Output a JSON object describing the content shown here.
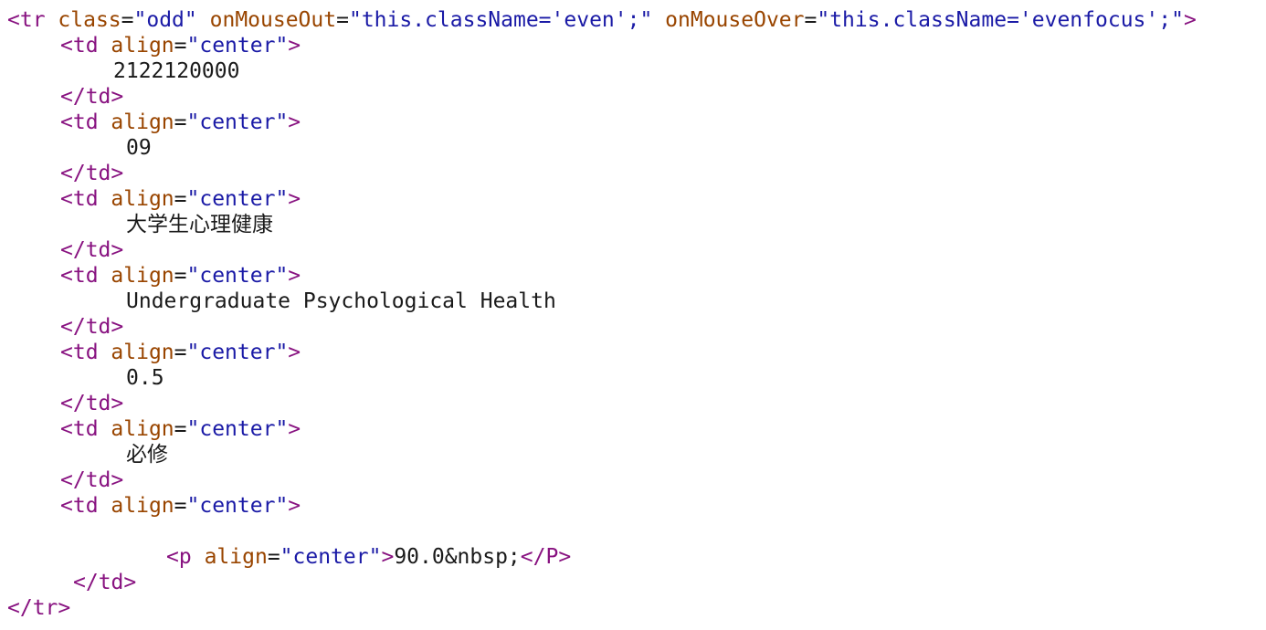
{
  "row_open": {
    "tag_open": "<tr",
    "attr_class": "class",
    "val_class": "\"odd\"",
    "attr_out": "onMouseOut",
    "val_out": "\"this.className='even';\"",
    "attr_over": "onMouseOver",
    "val_over": "\"this.className='evenfocus';\"",
    "close": ">"
  },
  "td_open": {
    "tag": "<td",
    "attr": "align",
    "val": "\"center\"",
    "close": ">"
  },
  "td_close": "</td>",
  "row_close": "</tr>",
  "cells": [
    "2122120000",
    "09",
    "大学生心理健康",
    "Undergraduate Psychological Health",
    "0.5",
    "必修"
  ],
  "last_cell": {
    "p_tag": "<p",
    "p_attr": "align",
    "p_val": "\"center\"",
    "p_gt": ">",
    "p_text": "90.0&nbsp;",
    "p_close": "</P>"
  }
}
